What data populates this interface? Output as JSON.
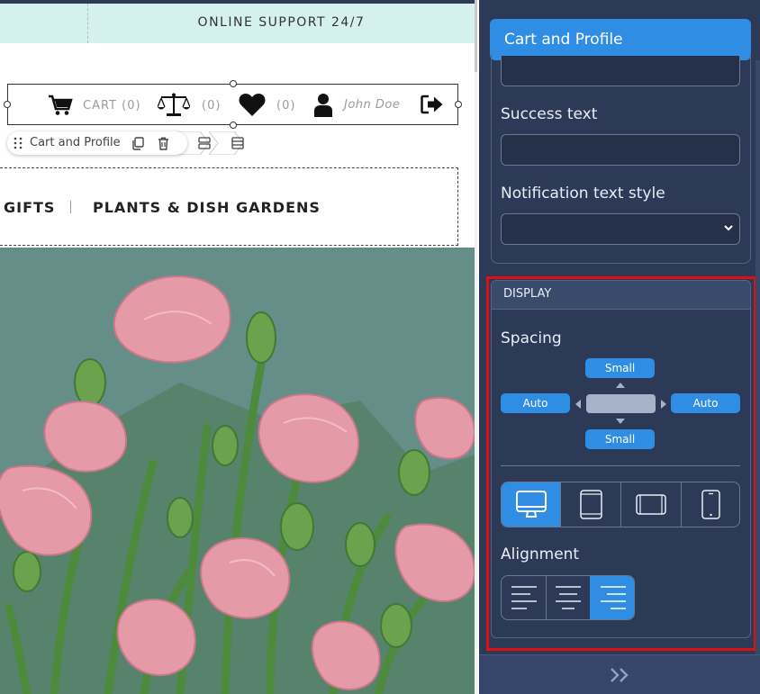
{
  "canvas": {
    "support_text": "ONLINE SUPPORT 24/7",
    "cart_profile": {
      "cart_label": "CART (0)",
      "compare_count": "(0)",
      "wishlist_count": "(0)",
      "user_name": "John Doe",
      "icons": [
        "cart-icon",
        "scales-icon",
        "heart-icon",
        "user-icon",
        "sign-out-icon"
      ]
    },
    "block_toolbar": {
      "label": "Cart and Profile",
      "icons": [
        "drag-handle-icon",
        "copy-icon",
        "trash-icon",
        "row-layout-icon",
        "column-layout-icon"
      ]
    },
    "nav": {
      "items": [
        "GIFTS",
        "PLANTS & DISH GARDENS"
      ]
    },
    "hero_image": "pink roses photo"
  },
  "panel": {
    "title": "Cart and Profile",
    "success_text_label": "Success text",
    "success_text_value": "",
    "notification_style_label": "Notification text style",
    "notification_style_value": "",
    "display": {
      "heading": "DISPLAY",
      "spacing_label": "Spacing",
      "spacing_top": "Small",
      "spacing_bottom": "Small",
      "spacing_left": "Auto",
      "spacing_right": "Auto",
      "devices": [
        "desktop-icon",
        "tablet-portrait-icon",
        "tablet-landscape-icon",
        "mobile-icon"
      ],
      "active_device": "desktop",
      "alignment_label": "Alignment",
      "alignments": [
        "align-left-icon",
        "align-center-icon",
        "align-right-icon"
      ],
      "active_alignment": "right"
    },
    "footer_icon": "double-chevron-right-icon"
  },
  "colors": {
    "panel_bg": "#2c3a57",
    "accent": "#2f8ee4",
    "highlight_outline": "#e01010",
    "support_bar": "#d4f1ef",
    "hero_bg": "#658e88"
  }
}
